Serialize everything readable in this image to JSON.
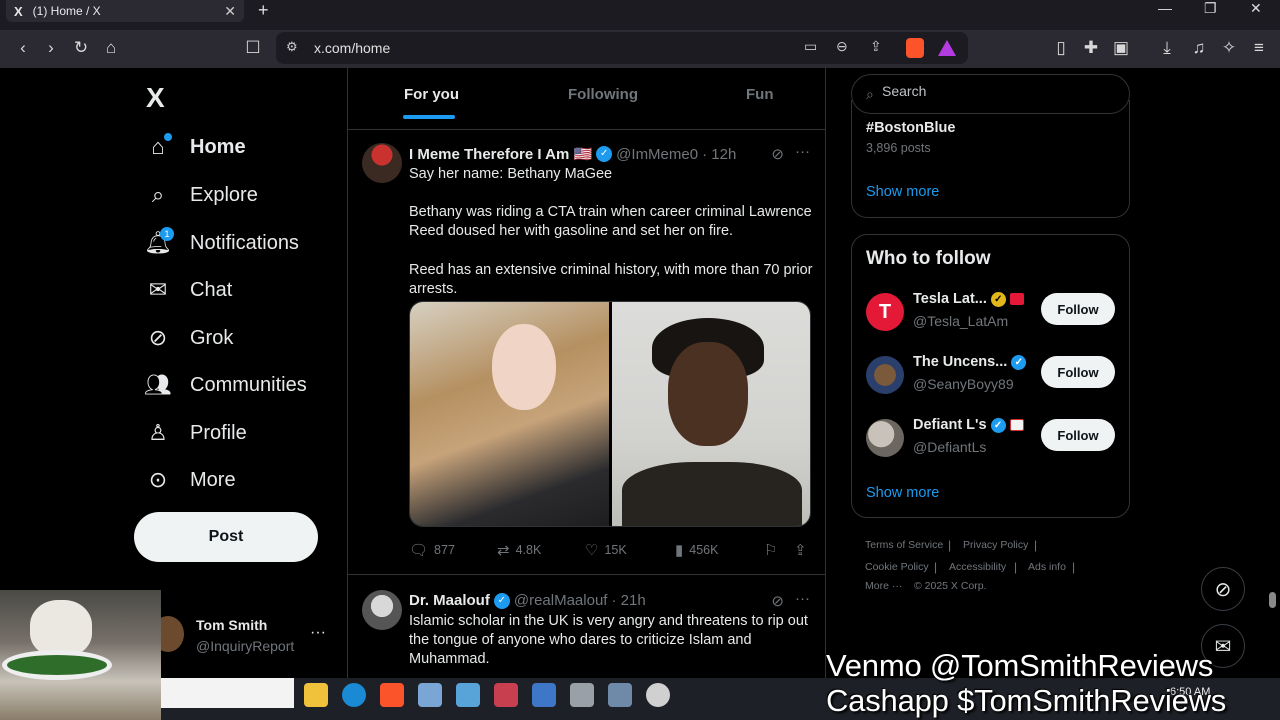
{
  "browser": {
    "tab_title": "(1) Home / X",
    "tab_logo": "X",
    "new_tab": "+",
    "url": "x.com/home"
  },
  "nav": {
    "logo": "X",
    "items": [
      {
        "label": "Home",
        "icon": "home-icon"
      },
      {
        "label": "Explore",
        "icon": "search-icon"
      },
      {
        "label": "Notifications",
        "icon": "bell-icon",
        "badge": "1"
      },
      {
        "label": "Chat",
        "icon": "mail-icon"
      },
      {
        "label": "Grok",
        "icon": "grok-icon"
      },
      {
        "label": "Communities",
        "icon": "people-icon"
      },
      {
        "label": "Profile",
        "icon": "person-icon"
      },
      {
        "label": "More",
        "icon": "more-circle-icon"
      }
    ],
    "post_label": "Post",
    "account": {
      "name": "Tom Smith",
      "handle": "@InquiryReport",
      "more": "···"
    }
  },
  "feed": {
    "tabs": [
      "For you",
      "Following",
      "Fun"
    ],
    "tweets": [
      {
        "name": "I Meme Therefore I Am 🇺🇸",
        "handle": "@ImMeme0",
        "time": "· 12h",
        "paragraphs": [
          "Say her name: Bethany MaGee",
          "Bethany was riding a CTA train when career criminal Lawrence Reed doused her with gasoline and set her on fire.",
          "Reed has an extensive criminal history, with more than 70 prior arrests."
        ],
        "stats": {
          "replies": "877",
          "reposts": "4.8K",
          "likes": "15K",
          "views": "456K"
        }
      },
      {
        "name": "Dr. Maalouf",
        "handle": "@realMaalouf",
        "time": "· 21h",
        "paragraphs": [
          "Islamic scholar in the UK is very angry and threatens to rip out the tongue of anyone who dares to criticize Islam and Muhammad."
        ]
      }
    ]
  },
  "sidebar": {
    "search_placeholder": "Search",
    "trend": {
      "name": "#BostonBlue",
      "count": "3,896 posts"
    },
    "show_more": "Show more",
    "who_to_follow": {
      "title": "Who to follow",
      "accounts": [
        {
          "name": "Tesla Lat...",
          "handle": "@Tesla_LatAm",
          "badge_color": "#e2b719",
          "button": "Follow"
        },
        {
          "name": "The Uncens...",
          "handle": "@SeanyBoyy89",
          "badge_color": "#1d9bf0",
          "button": "Follow"
        },
        {
          "name": "Defiant L's",
          "handle": "@DefiantLs",
          "badge_color": "#1d9bf0",
          "button": "Follow"
        }
      ],
      "show_more": "Show more"
    },
    "footer": {
      "links": [
        "Terms of Service",
        "Privacy Policy",
        "Cookie Policy",
        "Accessibility",
        "Ads info",
        "More ···"
      ],
      "copyright": "© 2025 X Corp."
    }
  },
  "overlay": {
    "venmo": "Venmo @TomSmithReviews",
    "cashapp": "Cashapp $TomSmithReviews"
  },
  "taskbar": {
    "time": "6:50 AM"
  },
  "colors": {
    "accent": "#1d9bf0",
    "background": "#000000",
    "text": "#e7e9ea",
    "muted": "#71767b"
  }
}
